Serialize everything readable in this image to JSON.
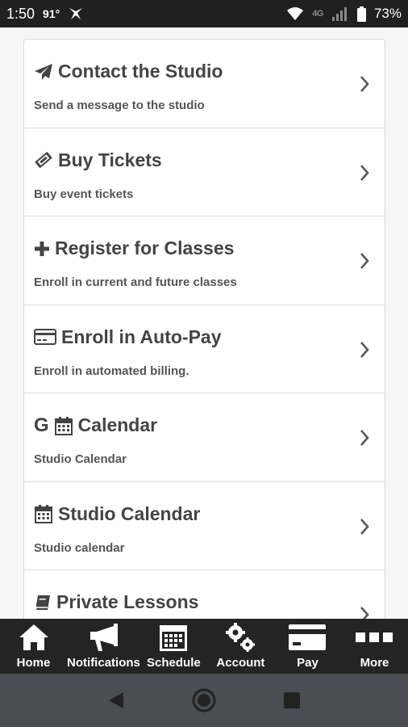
{
  "status_bar": {
    "time": "1:50",
    "temperature": "91°",
    "network": "4G",
    "battery": "73%"
  },
  "menu": {
    "items": [
      {
        "icon": "paper-plane-icon",
        "title": "Contact the Studio",
        "subtitle": "Send a message to the studio"
      },
      {
        "icon": "ticket-icon",
        "title": "Buy Tickets",
        "subtitle": "Buy event tickets"
      },
      {
        "icon": "plus-icon",
        "title": "Register for Classes",
        "subtitle": "Enroll in current and future classes"
      },
      {
        "icon": "credit-card-icon",
        "title": "Enroll in Auto-Pay",
        "subtitle": "Enroll in automated billing."
      },
      {
        "icon": "google-calendar-icon",
        "title": "Calendar",
        "subtitle": "Studio Calendar",
        "prefix": "G"
      },
      {
        "icon": "calendar-icon",
        "title": "Studio Calendar",
        "subtitle": "Studio calendar"
      },
      {
        "icon": "book-icon",
        "title": "Private Lessons",
        "subtitle": ""
      }
    ]
  },
  "bottom_nav": {
    "items": [
      {
        "icon": "home-icon",
        "label": "Home"
      },
      {
        "icon": "megaphone-icon",
        "label": "Notifications"
      },
      {
        "icon": "schedule-icon",
        "label": "Schedule"
      },
      {
        "icon": "gears-icon",
        "label": "Account"
      },
      {
        "icon": "credit-card-icon",
        "label": "Pay"
      },
      {
        "icon": "more-icon",
        "label": "More"
      }
    ]
  },
  "colors": {
    "status_bar_bg": "#202020",
    "nav_bg": "#242424",
    "system_nav_bg": "#4a4d51",
    "card_text": "#444444"
  }
}
